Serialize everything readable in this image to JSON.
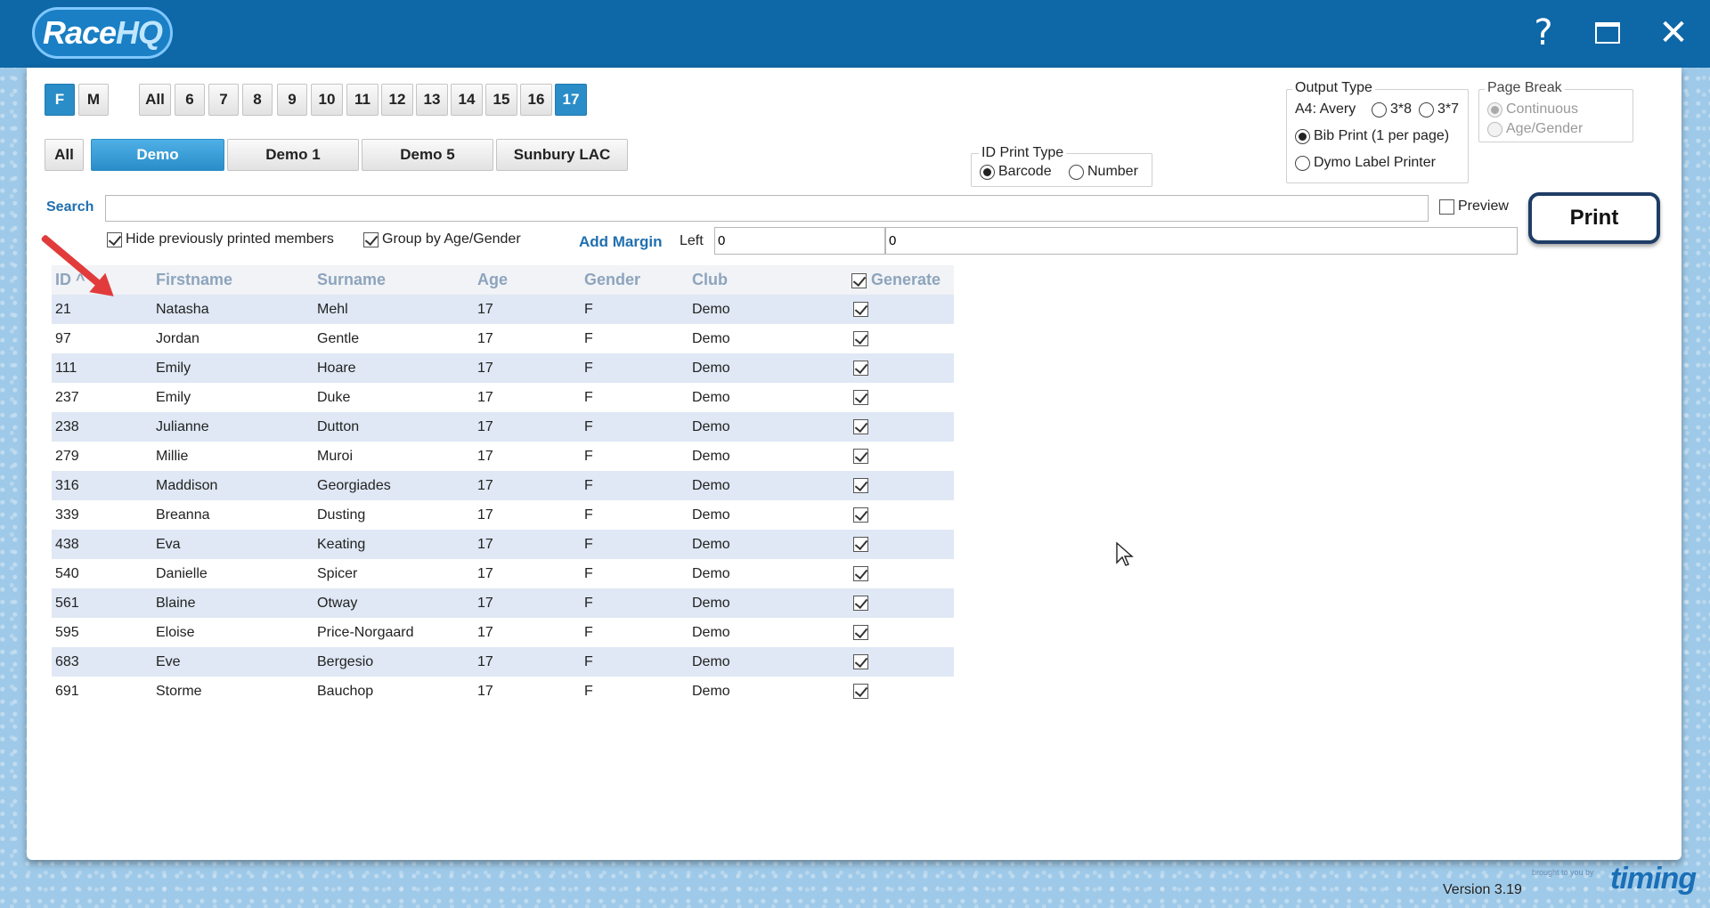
{
  "app": {
    "logo_race": "Race",
    "logo_hq": "HQ",
    "help": "?",
    "version": "Version 3.19",
    "brand_small": "brought to you by",
    "brand": "timing"
  },
  "gender_filters": [
    "F",
    "M"
  ],
  "age_filters": [
    "All",
    "6",
    "7",
    "8",
    "9",
    "10",
    "11",
    "12",
    "13",
    "14",
    "15",
    "16",
    "17"
  ],
  "club_filters": [
    "All",
    "Demo",
    "Demo 1",
    "Demo 5",
    "Sunbury LAC"
  ],
  "id_print_type": {
    "title": "ID Print Type",
    "options": [
      "Barcode",
      "Number"
    ],
    "selected": "Barcode"
  },
  "output_type": {
    "title": "Output Type",
    "a4_label": "A4: Avery",
    "opt_38": "3*8",
    "opt_37": "3*7",
    "bib": "Bib Print (1 per page)",
    "dymo": "Dymo Label Printer",
    "selected": "Bib Print (1 per page)"
  },
  "page_break": {
    "title": "Page Break",
    "options": [
      "Continuous",
      "Age/Gender"
    ],
    "selected": "Continuous"
  },
  "search": {
    "label": "Search",
    "value": ""
  },
  "preview_label": "Preview",
  "print_label": "Print",
  "hide_printed_label": "Hide previously printed members",
  "group_by_label": "Group by Age/Gender",
  "add_margin_label": "Add Margin",
  "left_label": "Left",
  "margin_left_value": "0",
  "margin_right_value": "0",
  "table": {
    "headers": [
      "ID",
      "Firstname",
      "Surname",
      "Age",
      "Gender",
      "Club",
      "Generate"
    ],
    "sort_indicator": "^",
    "rows": [
      [
        "21",
        "Natasha",
        "Mehl",
        "17",
        "F",
        "Demo"
      ],
      [
        "97",
        "Jordan",
        "Gentle",
        "17",
        "F",
        "Demo"
      ],
      [
        "111",
        "Emily",
        "Hoare",
        "17",
        "F",
        "Demo"
      ],
      [
        "237",
        "Emily",
        "Duke",
        "17",
        "F",
        "Demo"
      ],
      [
        "238",
        "Julianne",
        "Dutton",
        "17",
        "F",
        "Demo"
      ],
      [
        "279",
        "Millie",
        "Muroi",
        "17",
        "F",
        "Demo"
      ],
      [
        "316",
        "Maddison",
        "Georgiades",
        "17",
        "F",
        "Demo"
      ],
      [
        "339",
        "Breanna",
        "Dusting",
        "17",
        "F",
        "Demo"
      ],
      [
        "438",
        "Eva",
        "Keating",
        "17",
        "F",
        "Demo"
      ],
      [
        "540",
        "Danielle",
        "Spicer",
        "17",
        "F",
        "Demo"
      ],
      [
        "561",
        "Blaine",
        "Otway",
        "17",
        "F",
        "Demo"
      ],
      [
        "595",
        "Eloise",
        "Price-Norgaard",
        "17",
        "F",
        "Demo"
      ],
      [
        "683",
        "Eve",
        "Bergesio",
        "17",
        "F",
        "Demo"
      ],
      [
        "691",
        "Storme",
        "Bauchop",
        "17",
        "F",
        "Demo"
      ]
    ]
  }
}
